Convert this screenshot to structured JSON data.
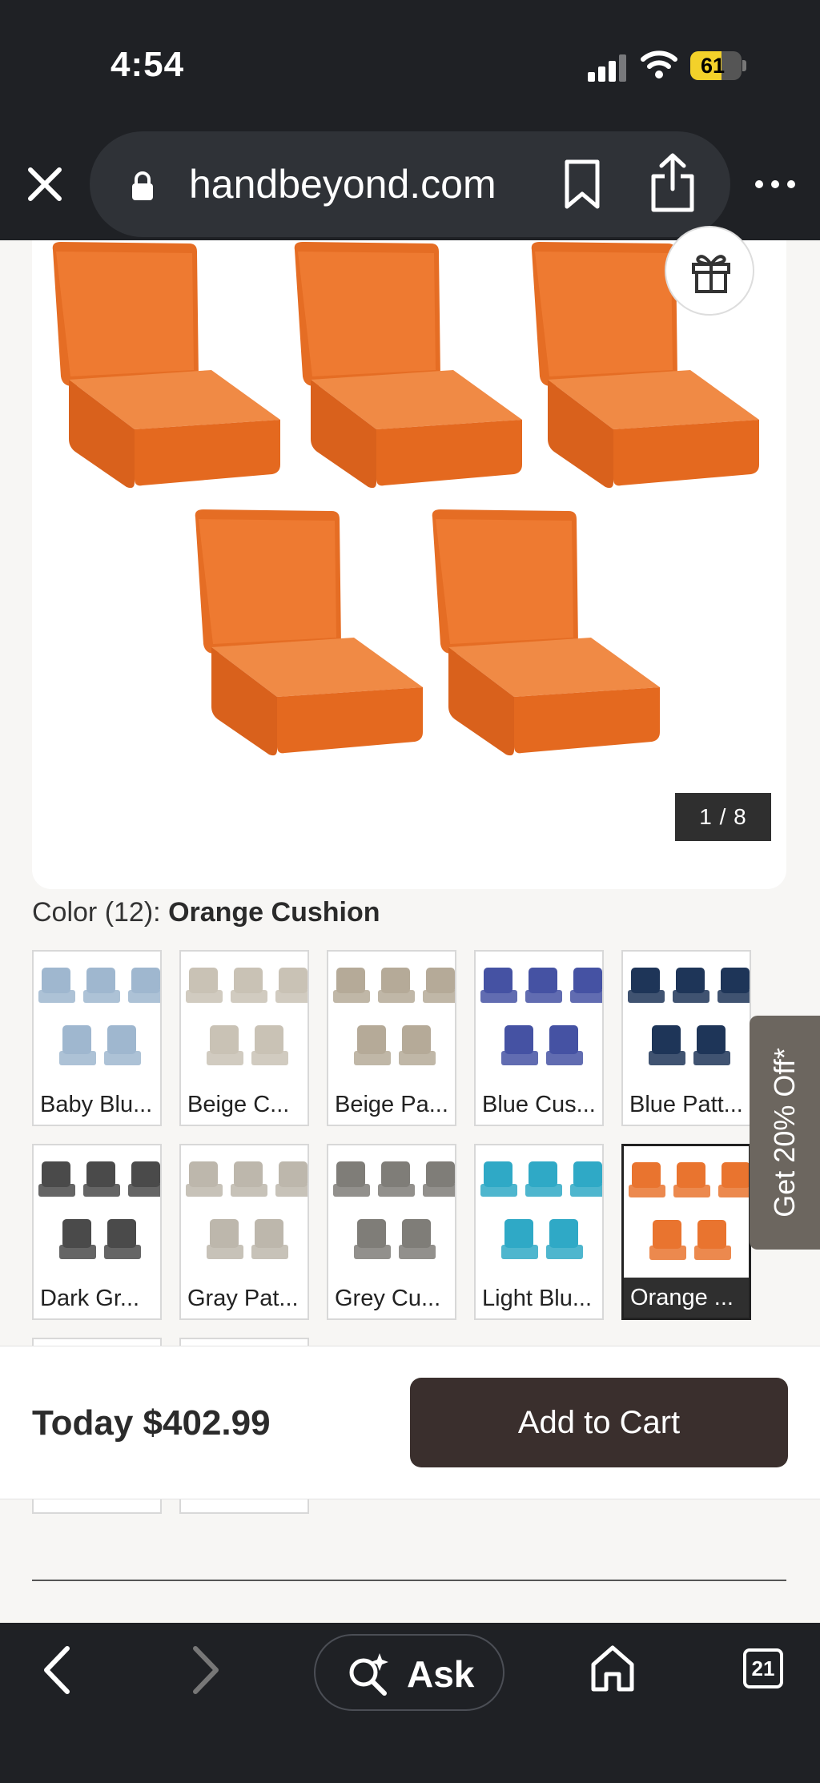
{
  "status_bar": {
    "time": "4:54",
    "battery": "61",
    "battery_level": 0.61
  },
  "browser": {
    "url": "handbeyond.com"
  },
  "gallery": {
    "counter": "1 / 8",
    "cushion_color": "#e9742f"
  },
  "color_selector": {
    "label": "Color (12): ",
    "selected": "Orange Cushion",
    "swatches": [
      {
        "caption": "Baby Blu...",
        "color": "#9fb7cf",
        "selected": false
      },
      {
        "caption": "Beige C...",
        "color": "#c9c2b5",
        "selected": false
      },
      {
        "caption": "Beige Pa...",
        "color": "#b5aa98",
        "selected": false
      },
      {
        "caption": "Blue Cus...",
        "color": "#4552a3",
        "selected": false
      },
      {
        "caption": "Blue Patt...",
        "color": "#1e3558",
        "selected": false
      },
      {
        "caption": "Dark Gr...",
        "color": "#4a4a4a",
        "selected": false
      },
      {
        "caption": "Gray Pat...",
        "color": "#bdb7ac",
        "selected": false
      },
      {
        "caption": "Grey Cu...",
        "color": "#7f7d78",
        "selected": false
      },
      {
        "caption": "Light Blu...",
        "color": "#2fa9c6",
        "selected": false
      },
      {
        "caption": "Orange ...",
        "color": "#e9742f",
        "selected": true
      }
    ]
  },
  "promo": {
    "label": "Get 20% Off*"
  },
  "cart": {
    "price": "Today $402.99",
    "button": "Add to Cart"
  },
  "toolbar": {
    "ask_label": "Ask",
    "tab_count": "21"
  }
}
